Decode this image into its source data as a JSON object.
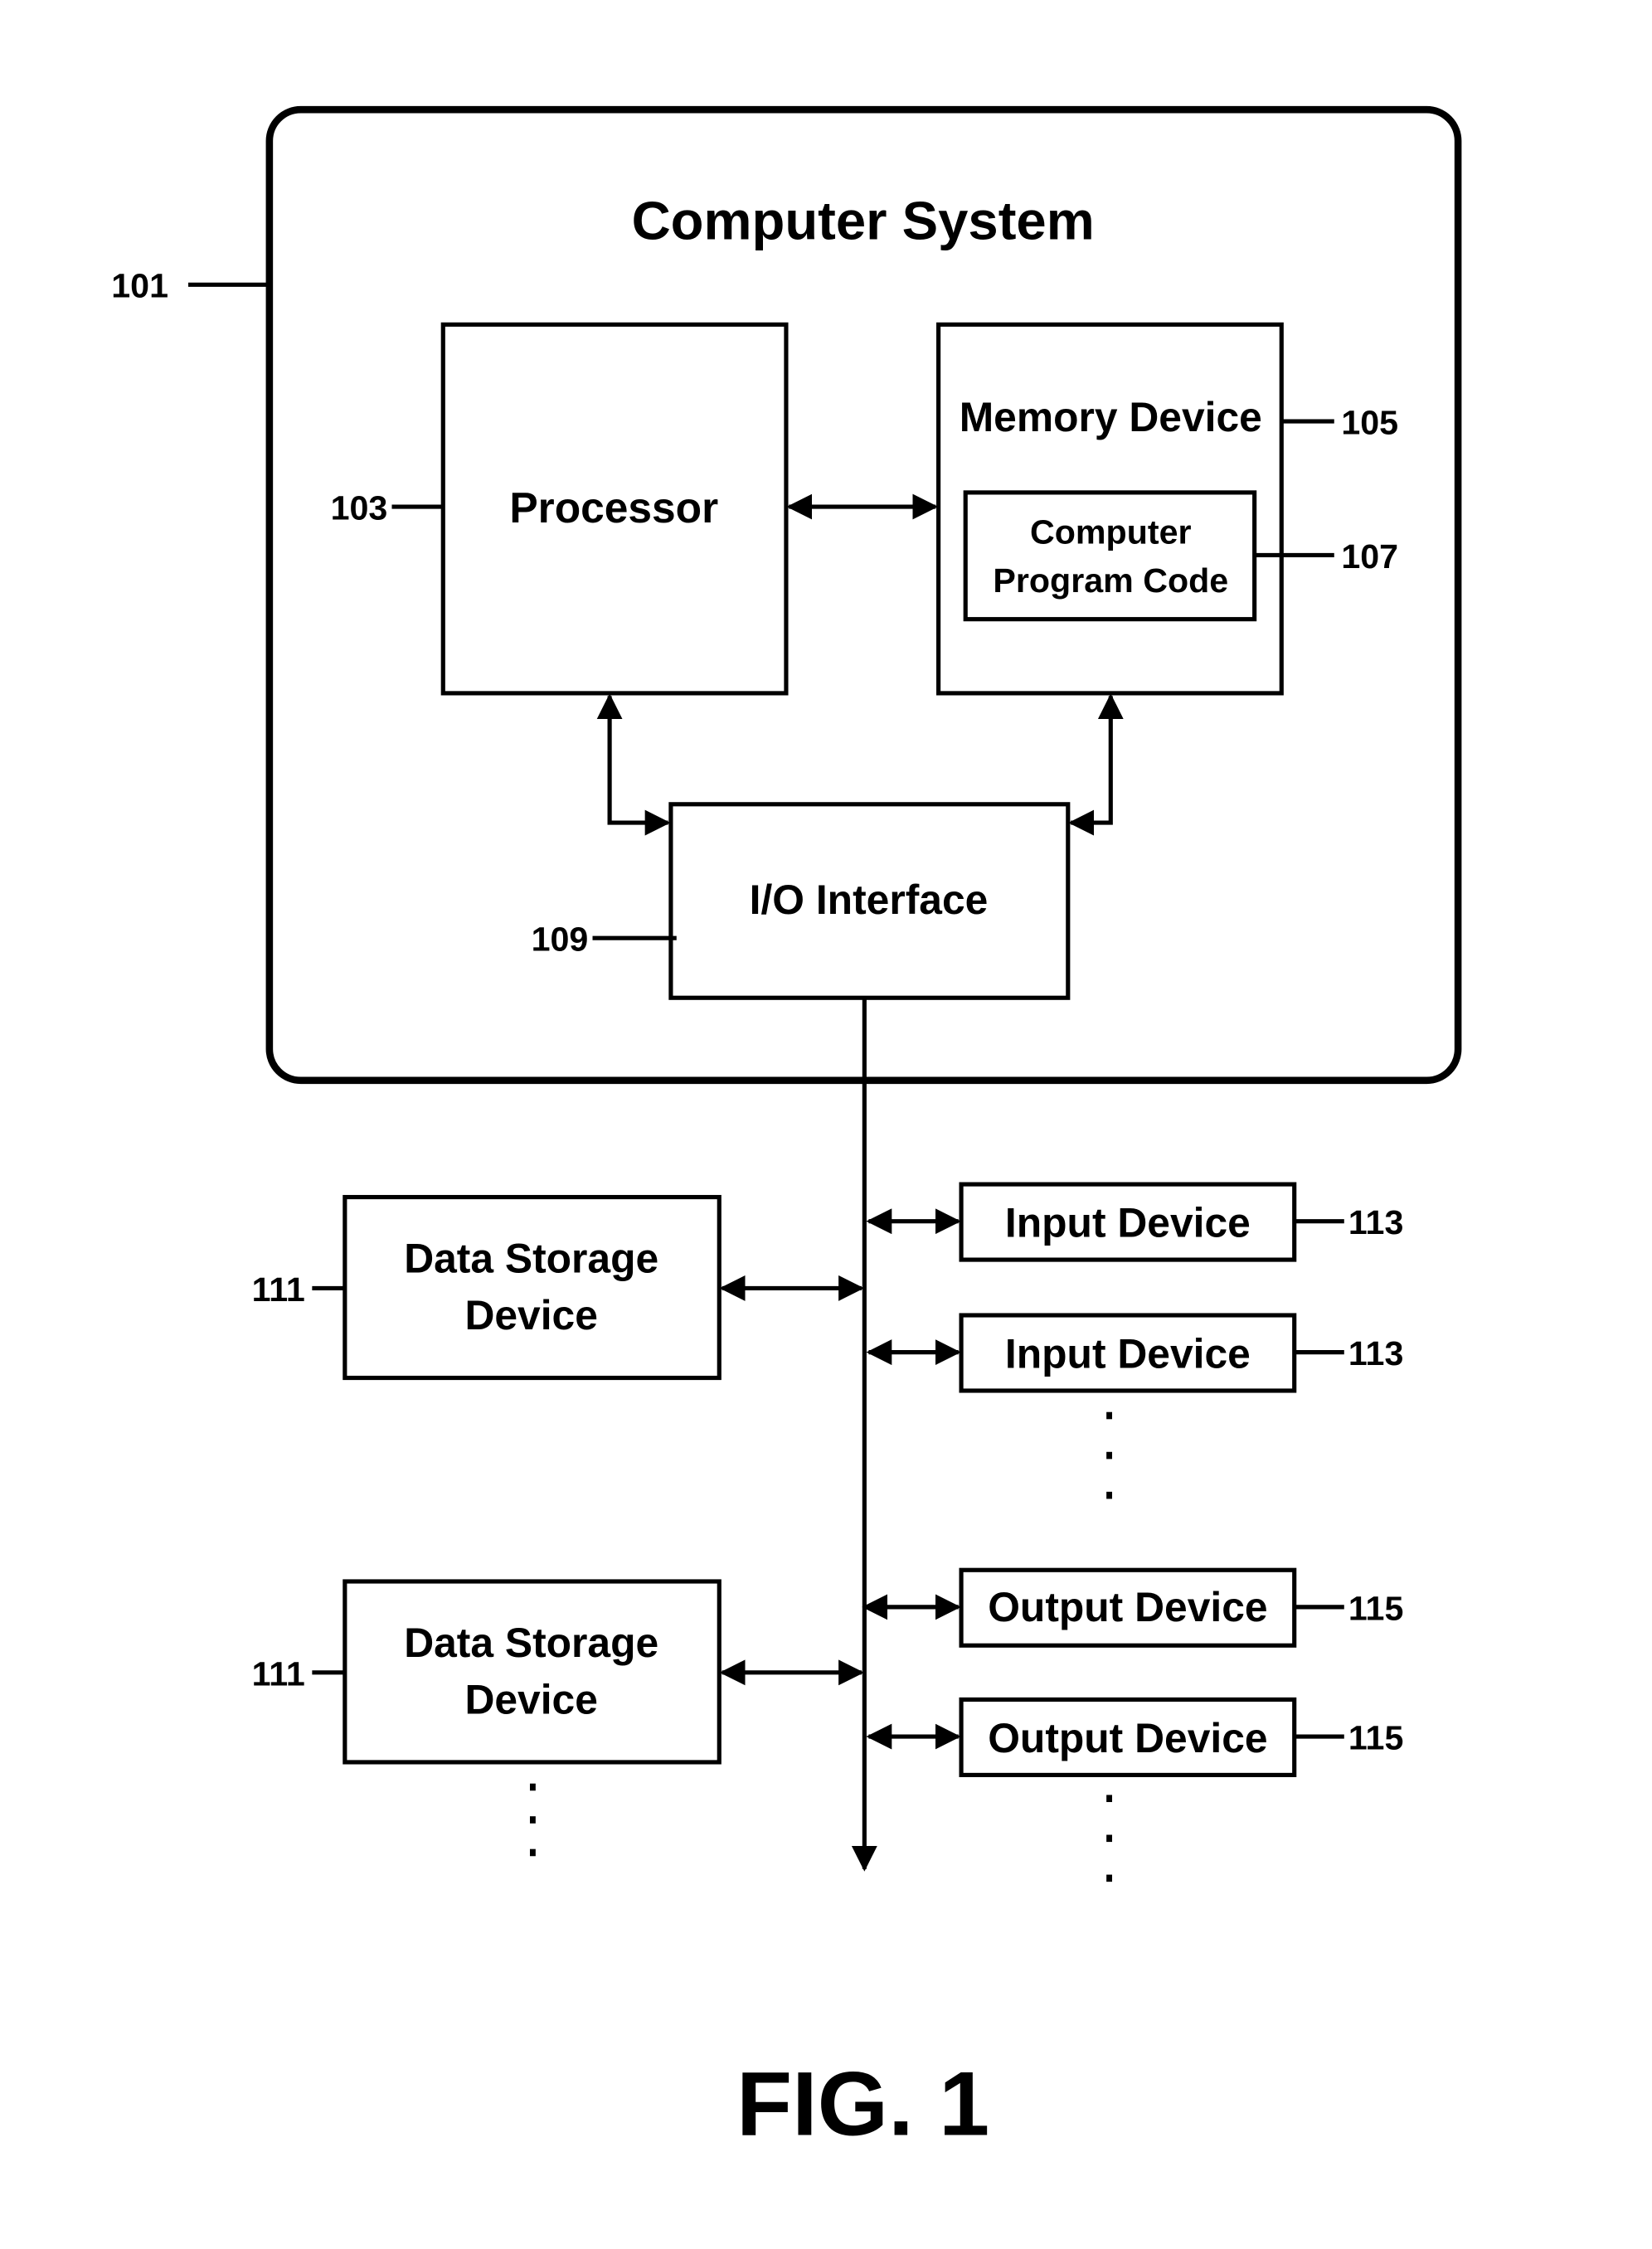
{
  "figure_label": "FIG. 1",
  "system": {
    "title": "Computer System",
    "ref": "101"
  },
  "processor": {
    "label": "Processor",
    "ref": "103"
  },
  "memory": {
    "label": "Memory Device",
    "ref": "105"
  },
  "program_code": {
    "line1": "Computer",
    "line2": "Program Code",
    "ref": "107"
  },
  "io": {
    "label": "I/O Interface",
    "ref": "109"
  },
  "storage": [
    {
      "line1": "Data Storage",
      "line2": "Device",
      "ref": "111"
    },
    {
      "line1": "Data Storage",
      "line2": "Device",
      "ref": "111"
    }
  ],
  "inputs": [
    {
      "label": "Input Device",
      "ref": "113"
    },
    {
      "label": "Input Device",
      "ref": "113"
    }
  ],
  "outputs": [
    {
      "label": "Output Device",
      "ref": "115"
    },
    {
      "label": "Output Device",
      "ref": "115"
    }
  ]
}
